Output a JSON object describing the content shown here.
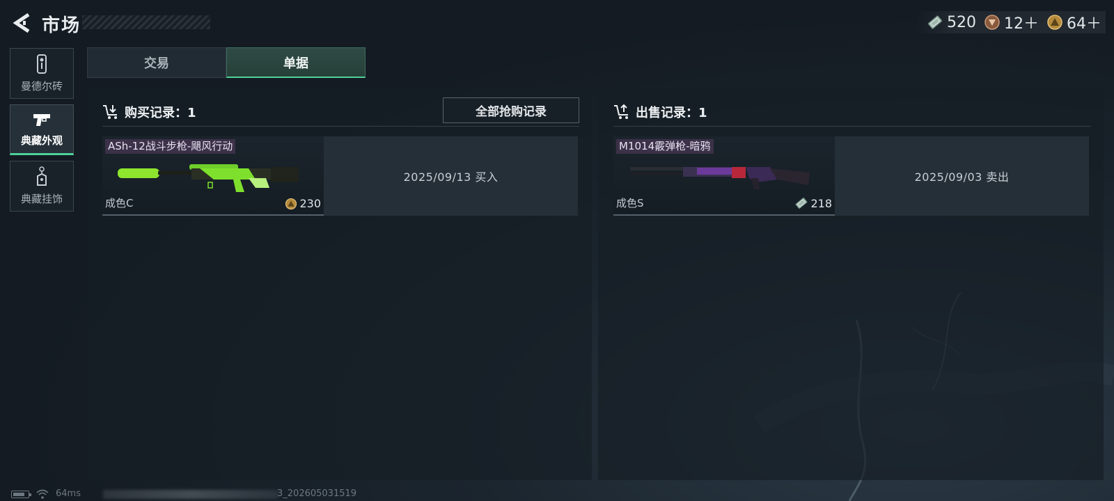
{
  "header": {
    "title": "市场",
    "currencies": [
      {
        "icon": "cash-ticket-icon",
        "value": "520"
      },
      {
        "icon": "bronze-medal-icon",
        "value": "12＋"
      },
      {
        "icon": "gold-triangle-coin-icon",
        "value": "64＋"
      }
    ]
  },
  "sidebar": {
    "items": [
      {
        "label": "曼德尔砖",
        "icon": "brick-icon",
        "active": false
      },
      {
        "label": "典藏外观",
        "icon": "pistol-icon",
        "active": true
      },
      {
        "label": "典藏挂饰",
        "icon": "charm-tag-icon",
        "active": false
      }
    ]
  },
  "tabs": [
    {
      "label": "交易",
      "active": false
    },
    {
      "label": "单据",
      "active": true
    }
  ],
  "purchase": {
    "title": "购买记录：1",
    "all_button": "全部抢购记录",
    "record": {
      "name": "ASh-12战斗步枪-飓风行动",
      "grade": "成色C",
      "price": "230",
      "price_icon": "gold-triangle-coin-icon",
      "info": "2025/09/13 买入"
    }
  },
  "sale": {
    "title": "出售记录：1",
    "record": {
      "name": "M1014霰弹枪-暗鸦",
      "grade": "成色S",
      "price": "218",
      "price_icon": "cash-ticket-icon",
      "info": "2025/09/03 卖出"
    }
  },
  "status": {
    "ping": "64ms",
    "build_suffix": "3_202605031519"
  },
  "colors": {
    "accent": "#4fd19a",
    "name_tag_bg": "#3b3148"
  }
}
